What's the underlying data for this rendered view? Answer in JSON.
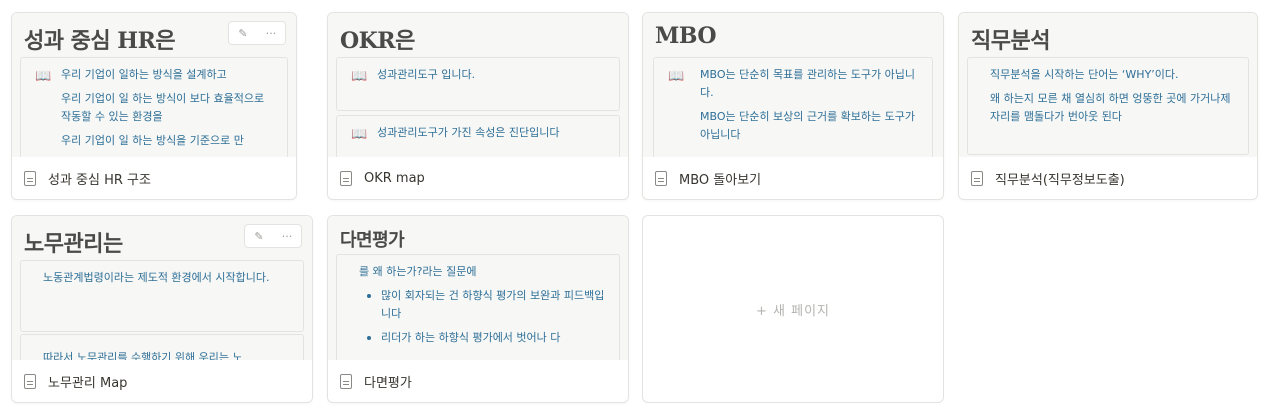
{
  "cards": [
    {
      "heading": "성과 중심 HR은",
      "quotes": [
        [
          "우리 기업이 일하는 방식을 설계하고",
          "우리 기업이 일 하는 방식이 보다 효율적으로 작동할 수 있는 환경을",
          "우리 기업이 일 하는 방식을 기준으로 만"
        ]
      ],
      "title": "성과 중심 HR 구조"
    },
    {
      "heading": "OKR은",
      "quotes": [
        [
          "성과관리도구 입니다."
        ],
        [
          "성과관리도구가 가진 속성은 진단입니다"
        ]
      ],
      "title": "OKR map"
    },
    {
      "heading": "MBO",
      "quotes": [
        [
          "MBO는 단순히 목표를 관리하는 도구가 아닙니다.",
          "MBO는 단순히 보상의 근거를 확보하는 도구가 아닙니다"
        ]
      ],
      "title": "MBO 돌아보기"
    },
    {
      "heading": "직무분석",
      "quotes": [
        [
          "직무분석을 시작하는 단어는 ‘WHY’이다.",
          "왜 하는지 모른 채 열심히 하면 엉뚱한 곳에 가거나제자리를 맴돌다가 번아웃 된다"
        ]
      ],
      "title": "직무분석(직무정보도출)"
    },
    {
      "heading": "노무관리는",
      "quotes": [
        [
          "노동관계법령이라는 제도적 환경에서 시작합니다."
        ],
        [
          "따라서 노무관리를 수행하기 위해 우리는 노"
        ]
      ],
      "title": "노무관리 Map"
    },
    {
      "heading": "다면평가",
      "intro": "를 왜 하는가?라는 질문에",
      "bullets": [
        "많이 회자되는 건 하향식 평가의 보완과 피드백입니다",
        "리더가 하는 하향식 평가에서 벗어나 다"
      ],
      "title": "다면평가"
    }
  ],
  "icons": {
    "toolbar_edit": "✎",
    "toolbar_more": "···",
    "book": "📖"
  },
  "new_page": {
    "label": "+ 새 페이지"
  },
  "colors": {
    "quote_text": "#2e6f98",
    "preview_bg": "#f7f7f5"
  }
}
